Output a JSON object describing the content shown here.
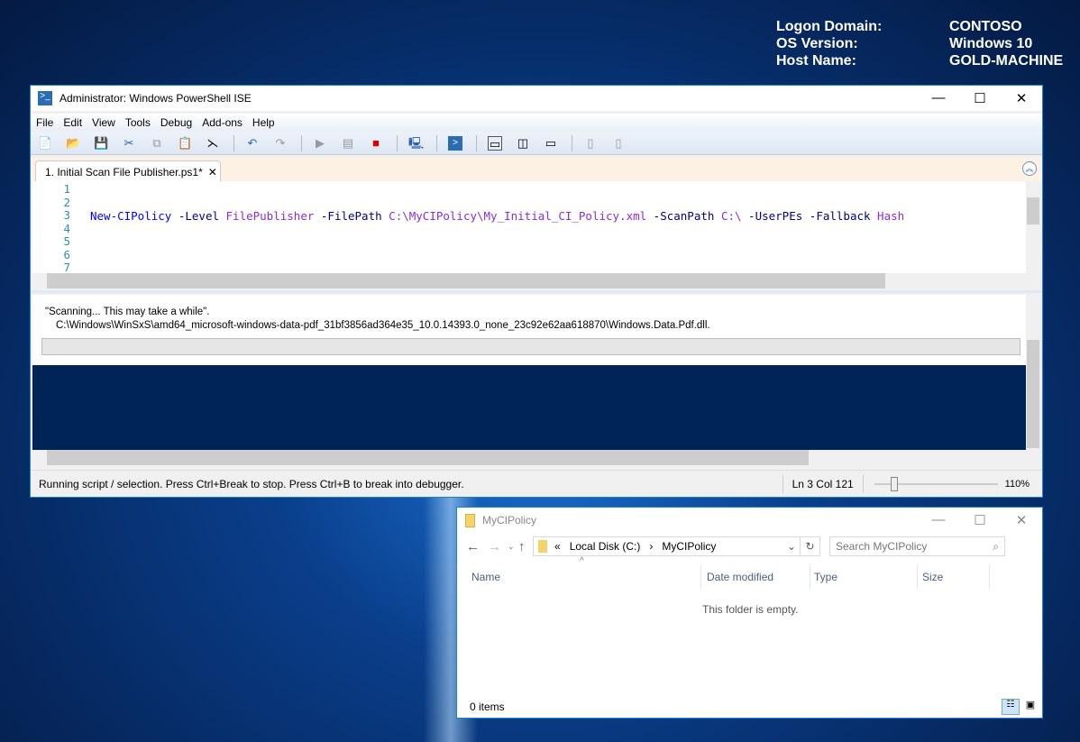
{
  "desktop": {
    "info": [
      {
        "k": "Logon Domain:",
        "v": "CONTOSO"
      },
      {
        "k": "OS Version:",
        "v": "Windows 10"
      },
      {
        "k": "Host Name:",
        "v": "GOLD-MACHINE"
      }
    ]
  },
  "ise": {
    "title": "Administrator: Windows PowerShell ISE",
    "menu": [
      "File",
      "Edit",
      "View",
      "Tools",
      "Debug",
      "Add-ons",
      "Help"
    ],
    "tab": "1. Initial Scan File Publisher.ps1*",
    "line_numbers": [
      "1",
      "2",
      "3",
      "4",
      "5",
      "6",
      "7"
    ],
    "code": [
      {
        "t": "New-CIPolicy",
        "c": "#0000ff"
      },
      {
        "t": " -Level ",
        "c": "#000080"
      },
      {
        "t": "FilePublisher",
        "c": "#8a2be2"
      },
      {
        "t": " -FilePath ",
        "c": "#000080"
      },
      {
        "t": "C:\\MyCIPolicy\\My_Initial_CI_Policy.xml",
        "c": "#8a2be2"
      },
      {
        "t": " -ScanPath ",
        "c": "#000080"
      },
      {
        "t": "C:\\",
        "c": "#8a2be2"
      },
      {
        "t": " -UserPEs -Fallback ",
        "c": "#000080"
      },
      {
        "t": "Hash",
        "c": "#8a2be2"
      }
    ],
    "output_line1": "\"Scanning... This may take a while\".",
    "output_line2": "C:\\Windows\\WinSxS\\amd64_microsoft-windows-data-pdf_31bf3856ad364e35_10.0.14393.0_none_23c92e62aa618870\\Windows.Data.Pdf.dll.",
    "status": "Running script / selection.  Press Ctrl+Break to stop.  Press Ctrl+B to break into debugger.",
    "position": "Ln 3  Col 121",
    "zoom": "110%",
    "zoom_value": 110,
    "console_bg": "#012456"
  },
  "explorer": {
    "title": "MyCIPolicy",
    "breadcrumb": [
      "«",
      "Local Disk (C:)",
      "›",
      "MyCIPolicy"
    ],
    "search_placeholder": "Search MyCIPolicy",
    "columns": [
      "Name",
      "Date modified",
      "Type",
      "Size"
    ],
    "empty": "This folder is empty.",
    "count": "0 items"
  }
}
